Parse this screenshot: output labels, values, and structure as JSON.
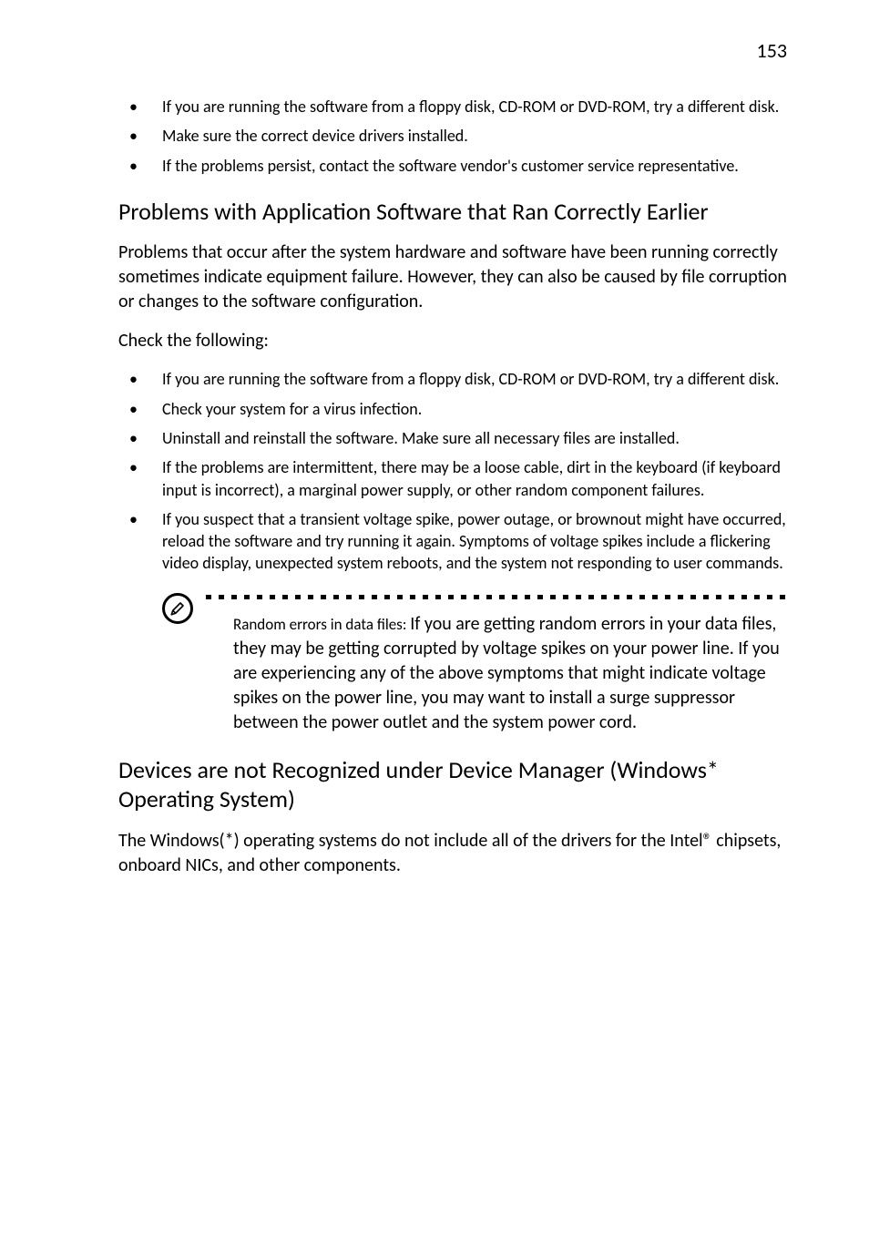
{
  "page_number": "153",
  "top_bullets": [
    "If you are running the software from a floppy disk, CD-ROM or DVD-ROM, try a different disk.",
    "Make sure the correct device drivers installed.",
    "If the problems persist, contact the software vendor's customer service representative."
  ],
  "section1": {
    "heading": "Problems with Application Software that Ran Correctly Earlier",
    "para1": "Problems that occur after the system hardware and software have been running correctly sometimes indicate equipment failure.  However, they can also be caused by file corruption or changes to the software configuration.",
    "para2": "Check the following:",
    "bullets": [
      "If you are running the software from a floppy disk, CD-ROM or DVD-ROM, try a different disk.",
      "Check your system for a virus infection.",
      "Uninstall and reinstall the software.  Make sure all necessary files are installed.",
      "If the problems are intermittent, there may be a loose cable, dirt in the keyboard (if keyboard input is incorrect), a marginal power supply, or other random component failures.",
      "If you suspect that a transient voltage spike, power outage, or brownout might have occurred, reload the software and try running it again.  Symptoms of voltage spikes include a flickering video display, unexpected system reboots, and the system not responding to user commands."
    ],
    "note": {
      "icon_name": "pencil-icon",
      "lead": "Random errors in data files:  ",
      "body": "If you are getting random errors in your data files, they may be getting corrupted by voltage spikes on your power line.  If you are experiencing any of the above symptoms that might indicate voltage spikes on the power line, you may want to install a surge suppressor between the power outlet and the system power cord."
    }
  },
  "section2": {
    "heading": "Devices are not Recognized under Device Manager (Windows* Operating System)",
    "para1": "The Windows(*) operating systems do not include all of the drivers for the Intel® chipsets, onboard NICs, and other components."
  }
}
